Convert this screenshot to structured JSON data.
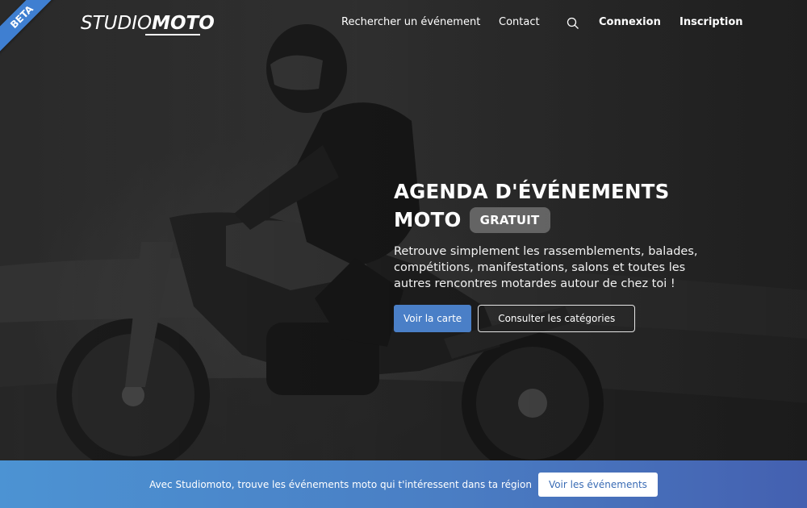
{
  "beta_label": "BETA",
  "logo": {
    "part1": "STUDIO",
    "part2": "MOTO"
  },
  "nav": {
    "search_events": "Rechercher un événement",
    "contact": "Contact",
    "login": "Connexion",
    "signup": "Inscription"
  },
  "hero": {
    "title_line1": "AGENDA D'ÉVÉNEMENTS",
    "title_line2": "MOTO",
    "badge": "GRATUIT",
    "description": "Retrouve simplement les rassemblements, balades, compétitions, manifestations, salons et toutes les autres rencontres motardes autour de chez toi !",
    "btn_map": "Voir la carte",
    "btn_categories": "Consulter les catégories"
  },
  "banner": {
    "text": "Avec Studiomoto, trouve les événements moto qui t'intéressent dans ta région",
    "button": "Voir les événements"
  },
  "colors": {
    "accent": "#4a7fc7",
    "ribbon": "#3f7fd1"
  },
  "icons": {
    "search": "search-icon"
  }
}
